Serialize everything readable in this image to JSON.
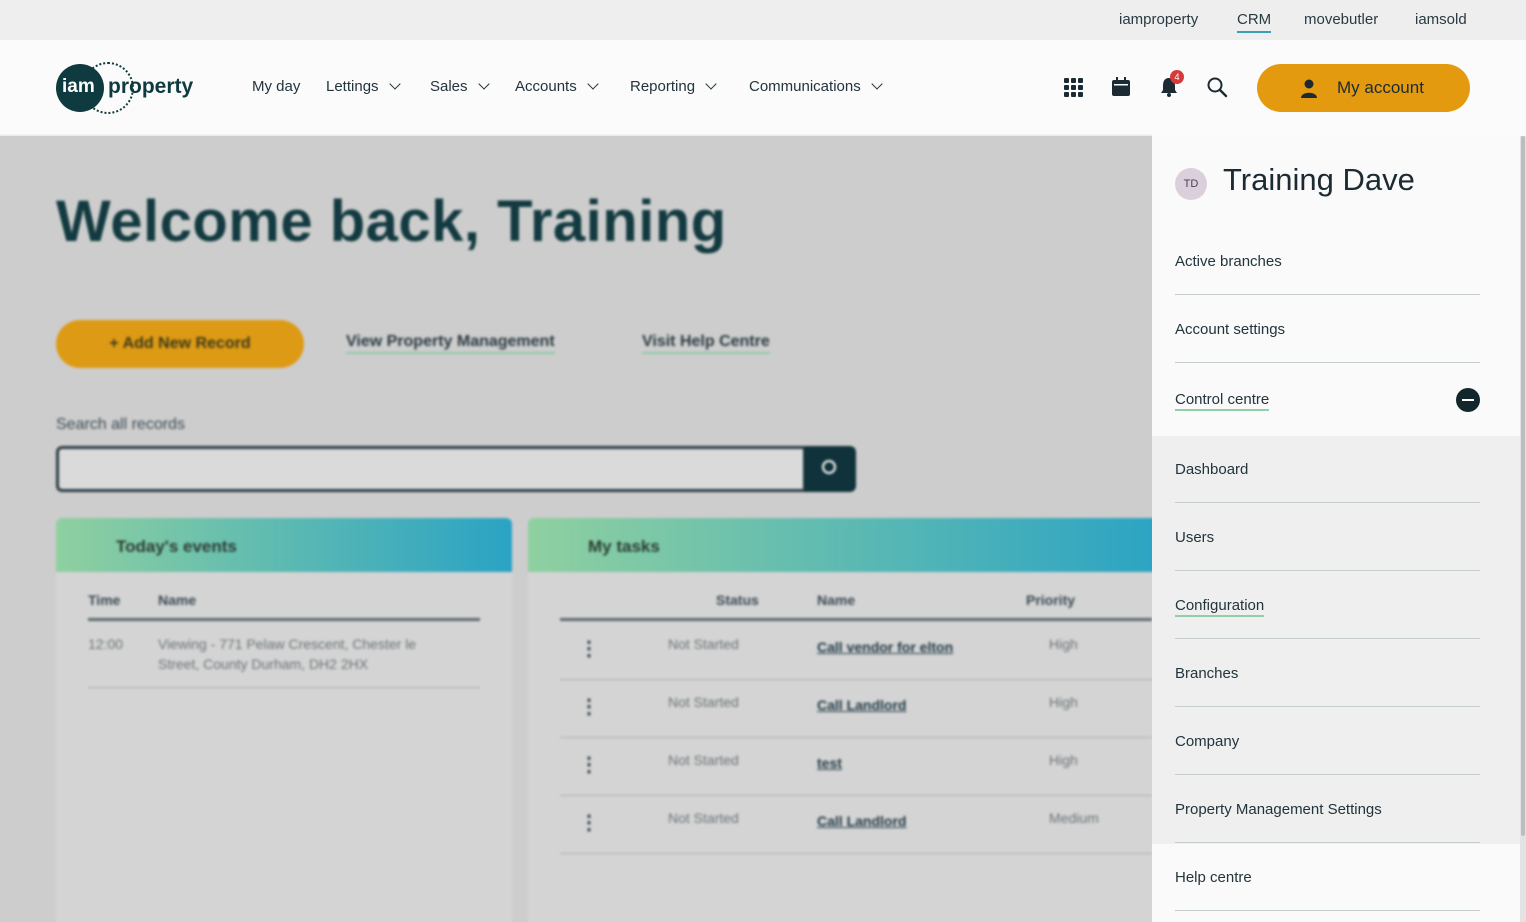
{
  "brand_links": [
    {
      "label": "iamproperty",
      "active": false
    },
    {
      "label": "CRM",
      "active": true
    },
    {
      "label": "movebutler",
      "active": false
    },
    {
      "label": "iamsold",
      "active": false
    }
  ],
  "logo": {
    "part1": "iam",
    "part2": "property"
  },
  "nav": [
    {
      "label": "My day",
      "has_dropdown": false
    },
    {
      "label": "Lettings",
      "has_dropdown": true
    },
    {
      "label": "Sales",
      "has_dropdown": true
    },
    {
      "label": "Accounts",
      "has_dropdown": true
    },
    {
      "label": "Reporting",
      "has_dropdown": true
    },
    {
      "label": "Communications",
      "has_dropdown": true
    }
  ],
  "header_icons": {
    "apps": "grid-icon",
    "calendar": "calendar-icon",
    "notifications": "bell-icon",
    "notification_count": "4",
    "search": "search-icon"
  },
  "account_button": {
    "label": "My account",
    "icon": "person-icon"
  },
  "main": {
    "welcome": "Welcome back, Training",
    "actions": {
      "add_record": "+ Add New Record",
      "view_pm": "View Property Management",
      "help": "Visit Help Centre"
    },
    "search": {
      "label": "Search all records",
      "placeholder": ""
    },
    "events_card": {
      "title": "Today's events",
      "columns": [
        "Time",
        "Name"
      ],
      "rows": [
        {
          "time": "12:00",
          "name_line1": "Viewing - 771 Pelaw Crescent, Chester le",
          "name_line2": "Street, County Durham, DH2 2HX"
        }
      ]
    },
    "tasks_card": {
      "title": "My tasks",
      "columns": [
        "Status",
        "Name",
        "Priority"
      ],
      "rows": [
        {
          "status": "Not Started",
          "name": "Call vendor for elton",
          "priority": "High"
        },
        {
          "status": "Not Started",
          "name": "Call Landlord",
          "priority": "High"
        },
        {
          "status": "Not Started",
          "name": "test",
          "priority": "High"
        },
        {
          "status": "Not Started",
          "name": "Call Landlord",
          "priority": "Medium"
        }
      ]
    }
  },
  "account_panel": {
    "initials": "TD",
    "name": "Training Dave",
    "items": [
      "Active branches",
      "Account settings"
    ],
    "control_centre": {
      "label": "Control centre",
      "expanded": true,
      "children": [
        "Dashboard",
        "Users",
        "Configuration",
        "Branches",
        "Company",
        "Property Management Settings"
      ]
    },
    "footer_items": [
      "Help centre"
    ]
  }
}
